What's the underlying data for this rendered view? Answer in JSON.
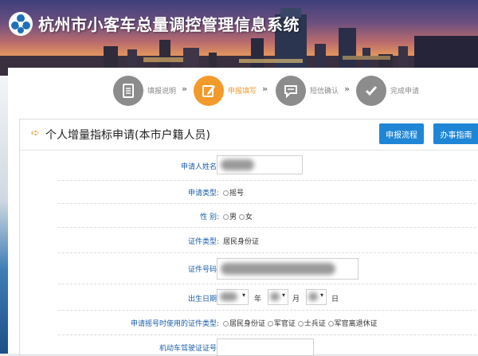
{
  "header": {
    "title": "杭州市小客车总量调控管理信息系统",
    "colors": {
      "accent": "#f39a2b",
      "brand_blue": "#1f86d6",
      "label_blue": "#1a5da8"
    }
  },
  "steps": [
    {
      "label": "填报说明",
      "icon": "document-icon",
      "active": false
    },
    {
      "label": "申报填写",
      "icon": "edit-icon",
      "active": true
    },
    {
      "label": "短信确认",
      "icon": "message-icon",
      "active": false
    },
    {
      "label": "完成申请",
      "icon": "check-icon",
      "active": false
    }
  ],
  "step_arrow": "»",
  "form": {
    "title": "个人增量指标申请(本市户籍人员)",
    "buttons": {
      "flow": "申报流程",
      "guide": "办事指南"
    },
    "fields": {
      "name_label": "申请人姓名:",
      "type_label": "申请类型:",
      "type_value": "摇号",
      "gender_label": "性  别:",
      "gender_male": "男",
      "gender_female": "女",
      "idtype_label": "证件类型:",
      "idtype_value": "居民身份证",
      "idno_label": "证件号码:",
      "birth_label": "出生日期:",
      "birth_year": "年",
      "birth_month": "月",
      "birth_day": "日",
      "dropdown_caret": "▾",
      "used_id_label": "申请摇号时使用的证件类型:",
      "used_id_options": [
        "居民身份证",
        "军官证",
        "士兵证",
        "军官离退休证"
      ],
      "license_label": "机动车驾驶证证号:"
    }
  }
}
